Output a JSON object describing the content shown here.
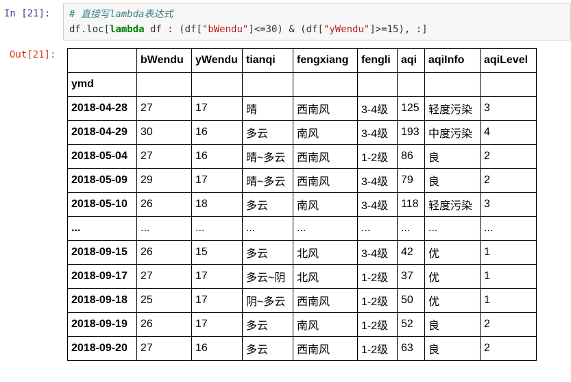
{
  "in_prompt": "In  [21]:",
  "out_prompt": "Out[21]:",
  "code": {
    "comment": "# 直接写lambda表达式",
    "line2": {
      "p1": "df.loc[",
      "kw": "lambda",
      "p2": " df : (df[",
      "s1": "\"bWendu\"",
      "p3": "]<=30) & (df[",
      "s2": "\"yWendu\"",
      "p4": "]>=15), :]"
    }
  },
  "table": {
    "columns": [
      "bWendu",
      "yWendu",
      "tianqi",
      "fengxiang",
      "fengli",
      "aqi",
      "aqiInfo",
      "aqiLevel"
    ],
    "index_name": "ymd",
    "rows": [
      {
        "index": "2018-04-28",
        "cells": [
          "27",
          "17",
          "晴",
          "西南风",
          "3-4级",
          "125",
          "轻度污染",
          "3"
        ]
      },
      {
        "index": "2018-04-29",
        "cells": [
          "30",
          "16",
          "多云",
          "南风",
          "3-4级",
          "193",
          "中度污染",
          "4"
        ]
      },
      {
        "index": "2018-05-04",
        "cells": [
          "27",
          "16",
          "晴~多云",
          "西南风",
          "1-2级",
          "86",
          "良",
          "2"
        ]
      },
      {
        "index": "2018-05-09",
        "cells": [
          "29",
          "17",
          "晴~多云",
          "西南风",
          "3-4级",
          "79",
          "良",
          "2"
        ]
      },
      {
        "index": "2018-05-10",
        "cells": [
          "26",
          "18",
          "多云",
          "南风",
          "3-4级",
          "118",
          "轻度污染",
          "3"
        ]
      },
      {
        "index": "...",
        "cells": [
          "...",
          "...",
          "...",
          "...",
          "...",
          "...",
          "...",
          "..."
        ]
      },
      {
        "index": "2018-09-15",
        "cells": [
          "26",
          "15",
          "多云",
          "北风",
          "3-4级",
          "42",
          "优",
          "1"
        ]
      },
      {
        "index": "2018-09-17",
        "cells": [
          "27",
          "17",
          "多云~阴",
          "北风",
          "1-2级",
          "37",
          "优",
          "1"
        ]
      },
      {
        "index": "2018-09-18",
        "cells": [
          "25",
          "17",
          "阴~多云",
          "西南风",
          "1-2级",
          "50",
          "优",
          "1"
        ]
      },
      {
        "index": "2018-09-19",
        "cells": [
          "26",
          "17",
          "多云",
          "南风",
          "1-2级",
          "52",
          "良",
          "2"
        ]
      },
      {
        "index": "2018-09-20",
        "cells": [
          "27",
          "16",
          "多云",
          "西南风",
          "1-2级",
          "63",
          "良",
          "2"
        ]
      }
    ]
  }
}
